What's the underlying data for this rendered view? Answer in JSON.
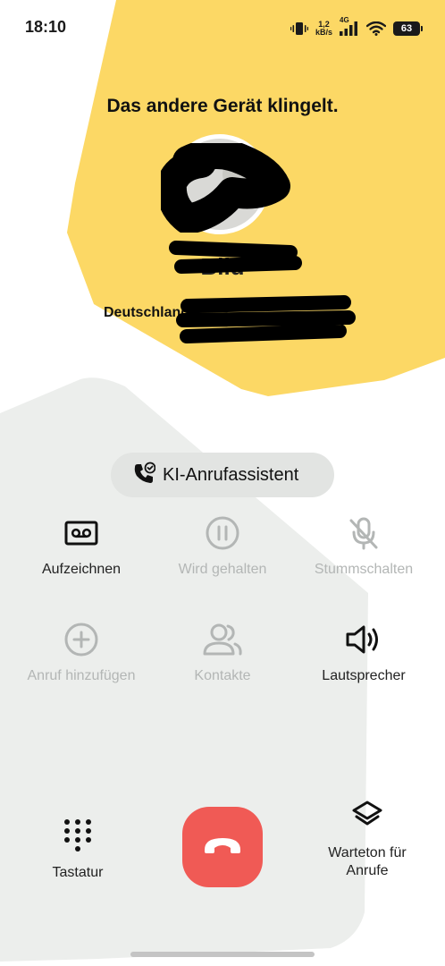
{
  "status_bar": {
    "time": "18:10",
    "net_speed_value": "1,2",
    "net_speed_unit": "kB/s",
    "network_type": "4G",
    "battery_level": "63",
    "icons": [
      "vibrate-icon",
      "signal-icon",
      "wifi-icon",
      "battery-icon"
    ]
  },
  "call": {
    "status_text": "Das andere Gerät klingelt.",
    "caller_name_partial": "Bild",
    "caller_location_partial": "Deutschland"
  },
  "ai_assistant": {
    "label": "KI-Anrufassistent",
    "icon": "phone-ai-icon"
  },
  "controls": [
    {
      "label": "Aufzeichnen",
      "icon": "record-icon",
      "enabled": true
    },
    {
      "label": "Wird gehalten",
      "icon": "pause-icon",
      "enabled": false
    },
    {
      "label": "Stummschalten",
      "icon": "mute-icon",
      "enabled": false
    },
    {
      "label": "Anruf hinzufügen",
      "icon": "add-call-icon",
      "enabled": false
    },
    {
      "label": "Kontakte",
      "icon": "contacts-icon",
      "enabled": false
    },
    {
      "label": "Lautsprecher",
      "icon": "speaker-icon",
      "enabled": true
    }
  ],
  "bottom": {
    "keypad_label": "Tastatur",
    "end_call_icon": "hang-up-icon",
    "hold_music_label_line1": "Warteton für",
    "hold_music_label_line2": "Anrufe"
  },
  "colors": {
    "accent_yellow": "#fcd865",
    "panel_gray": "#eceeec",
    "end_call_red": "#f05a55",
    "disabled_gray": "#b3b6b5"
  }
}
